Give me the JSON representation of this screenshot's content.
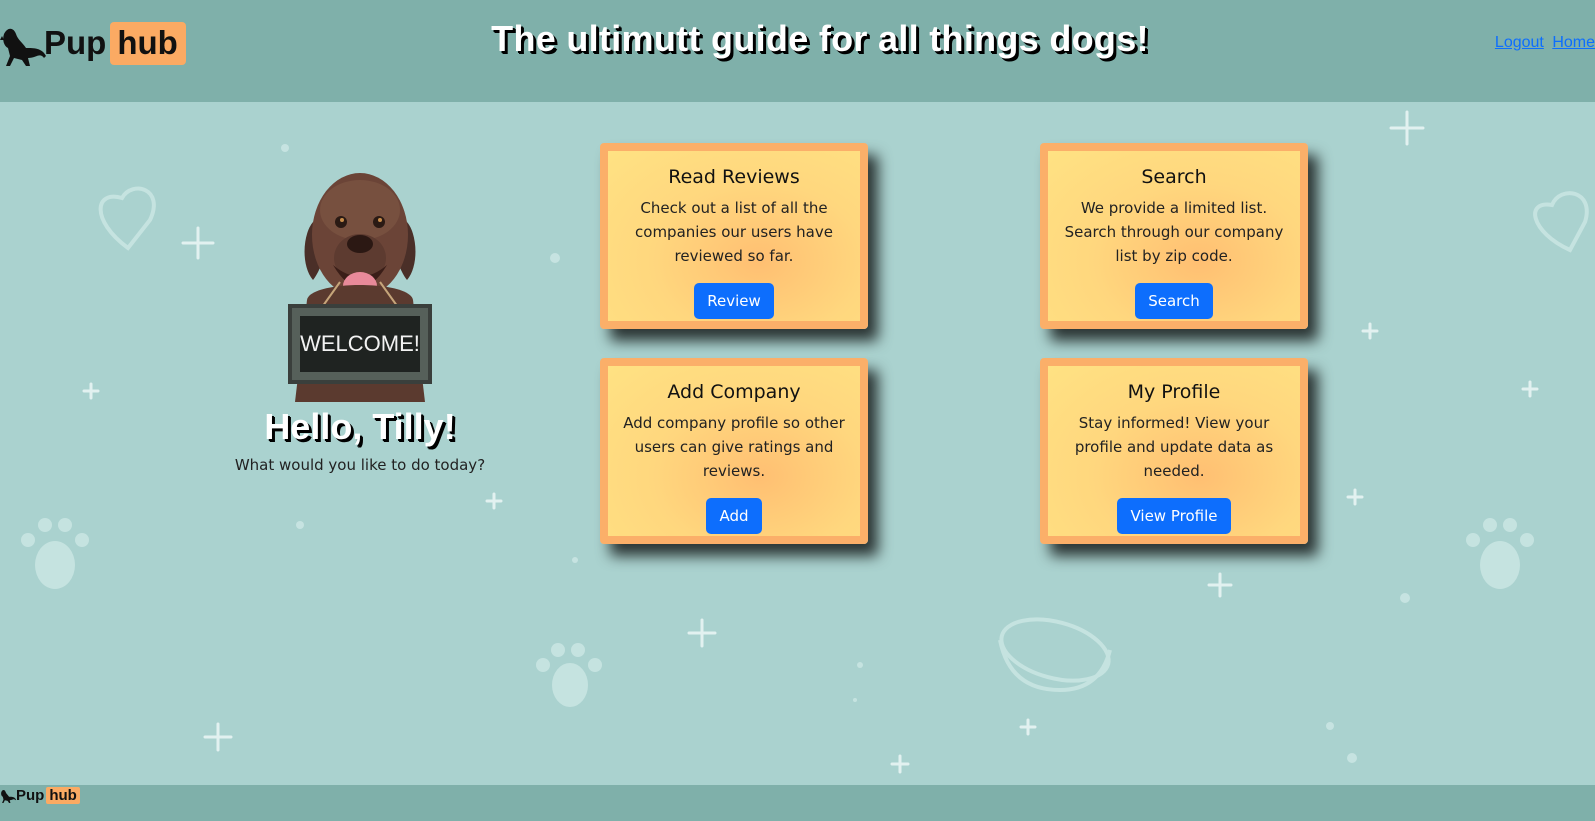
{
  "header": {
    "logo_pup": "Pup",
    "logo_hub": "hub",
    "title": "The ultimutt guide for all things dogs!",
    "nav": [
      {
        "label": "Logout"
      },
      {
        "label": "Home"
      }
    ]
  },
  "welcome": {
    "sign_text": "WELCOME!",
    "greeting": "Hello, Tilly!",
    "prompt": "What would you like to do today?"
  },
  "cards": [
    {
      "title": "Read Reviews",
      "text": "Check out a list of all the companies our users have reviewed so far.",
      "button": "Review"
    },
    {
      "title": "Search",
      "text": "We provide a limited list. Search through our company list by zip code.",
      "button": "Search"
    },
    {
      "title": "Add Company",
      "text": "Add company profile so other users can give ratings and reviews.",
      "button": "Add"
    },
    {
      "title": "My Profile",
      "text": "Stay informed! View your profile and update data as needed.",
      "button": "View Profile"
    }
  ],
  "footer": {
    "logo_pup": "Pup",
    "logo_hub": "hub"
  },
  "colors": {
    "background": "#aad2cf",
    "header_bar": "#7fb0aa",
    "card_border": "#fbaf69",
    "card_fill": "#ffe283",
    "button": "#0d6efd",
    "logo_hub_bg": "#fbaa63"
  }
}
